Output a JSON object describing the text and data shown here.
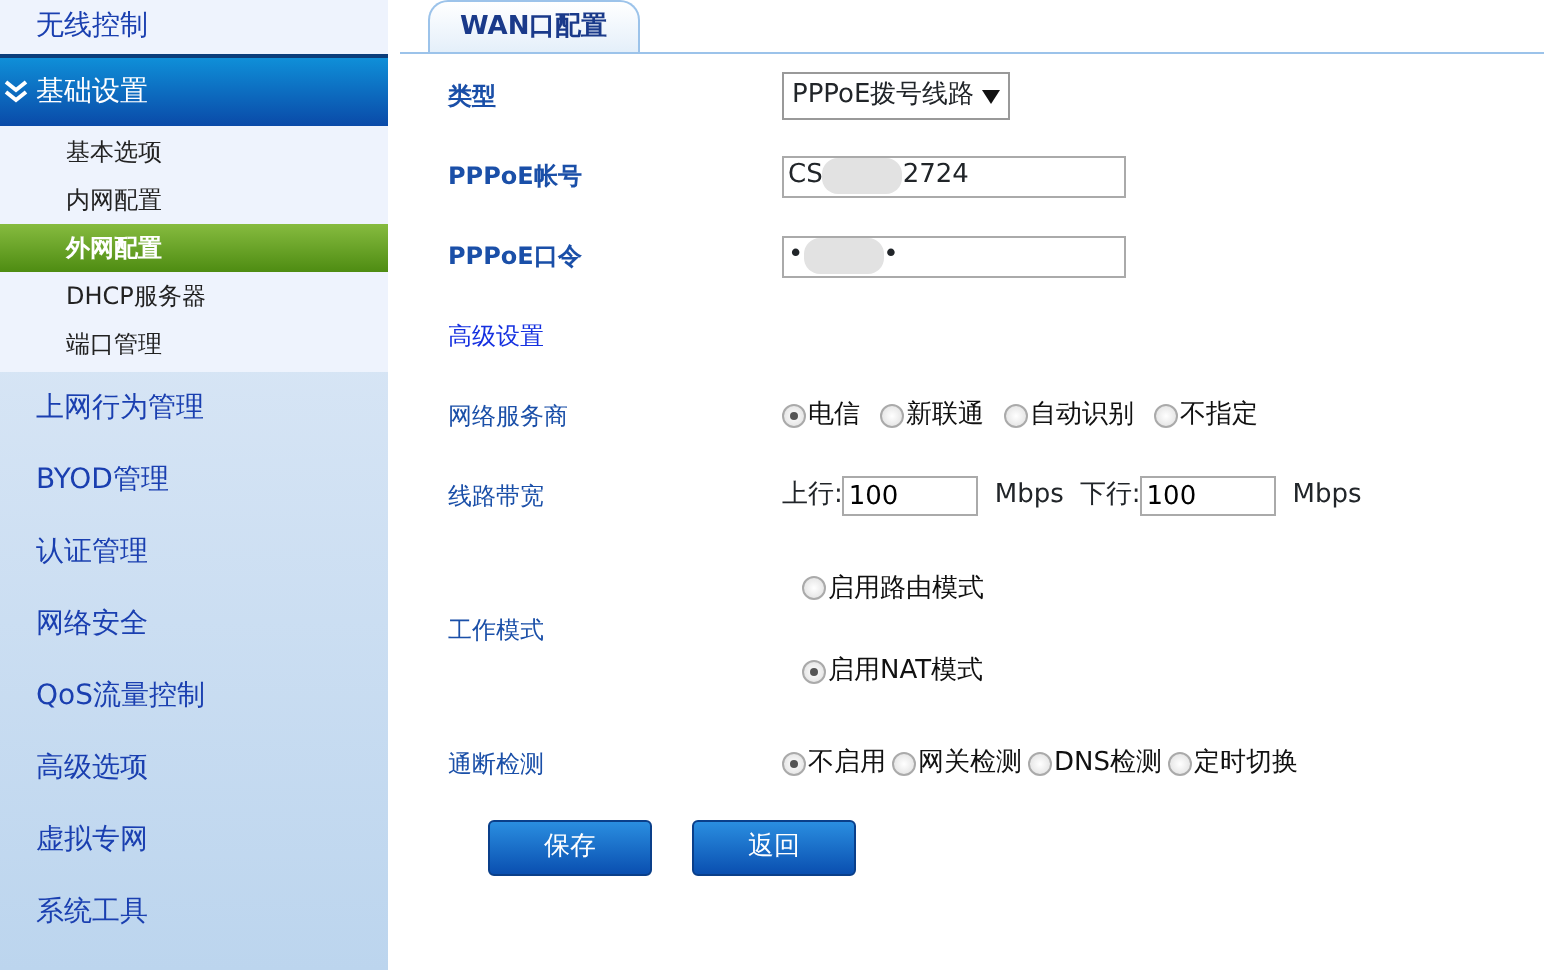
{
  "sidebar": {
    "items": [
      {
        "label": "无线控制",
        "expanded": false
      },
      {
        "label": "基础设置",
        "expanded": true,
        "children": [
          {
            "label": "基本选项",
            "selected": false
          },
          {
            "label": "内网配置",
            "selected": false
          },
          {
            "label": "外网配置",
            "selected": true
          },
          {
            "label": "DHCP服务器",
            "selected": false
          },
          {
            "label": "端口管理",
            "selected": false
          }
        ]
      },
      {
        "label": "上网行为管理",
        "expanded": false
      },
      {
        "label": "BYOD管理",
        "expanded": false
      },
      {
        "label": "认证管理",
        "expanded": false
      },
      {
        "label": "网络安全",
        "expanded": false
      },
      {
        "label": "QoS流量控制",
        "expanded": false
      },
      {
        "label": "高级选项",
        "expanded": false
      },
      {
        "label": "虚拟专网",
        "expanded": false
      },
      {
        "label": "系统工具",
        "expanded": false
      }
    ]
  },
  "tabs": [
    {
      "label": "WAN口配置",
      "selected": true
    }
  ],
  "form": [
    {
      "kind": "select",
      "label": "类型",
      "value": "PPPoE拨号线路"
    },
    {
      "kind": "masked",
      "label": "PPPoE帐号",
      "parts": [
        "CS",
        "2724"
      ]
    },
    {
      "kind": "masked",
      "label": "PPPoE口令",
      "parts": [
        "•",
        "•"
      ]
    },
    {
      "kind": "heading",
      "label": "高级设置"
    },
    {
      "kind": "radio",
      "label": "网络服务商",
      "options": [
        {
          "label": "电信",
          "selected": true
        },
        {
          "label": "新联通",
          "selected": false
        },
        {
          "label": "自动识别",
          "selected": false
        },
        {
          "label": "不指定",
          "selected": false
        }
      ]
    },
    {
      "kind": "bandwidth",
      "label": "线路带宽",
      "fields": [
        {
          "label": "上行:",
          "value": "100",
          "unit": "Mbps"
        },
        {
          "label": "下行:",
          "value": "100",
          "unit": "Mbps"
        }
      ]
    },
    {
      "kind": "radio_stack",
      "label": "工作模式",
      "options": [
        {
          "label": "启用路由模式",
          "selected": false
        },
        {
          "label": "启用NAT模式",
          "selected": true
        }
      ]
    },
    {
      "kind": "radio_tight",
      "label": "通断检测",
      "options": [
        {
          "label": "不启用",
          "selected": true
        },
        {
          "label": "网关检测",
          "selected": false
        },
        {
          "label": "DNS检测",
          "selected": false
        },
        {
          "label": "定时切换",
          "selected": false
        }
      ]
    }
  ],
  "buttons": [
    "保存",
    "返回"
  ]
}
